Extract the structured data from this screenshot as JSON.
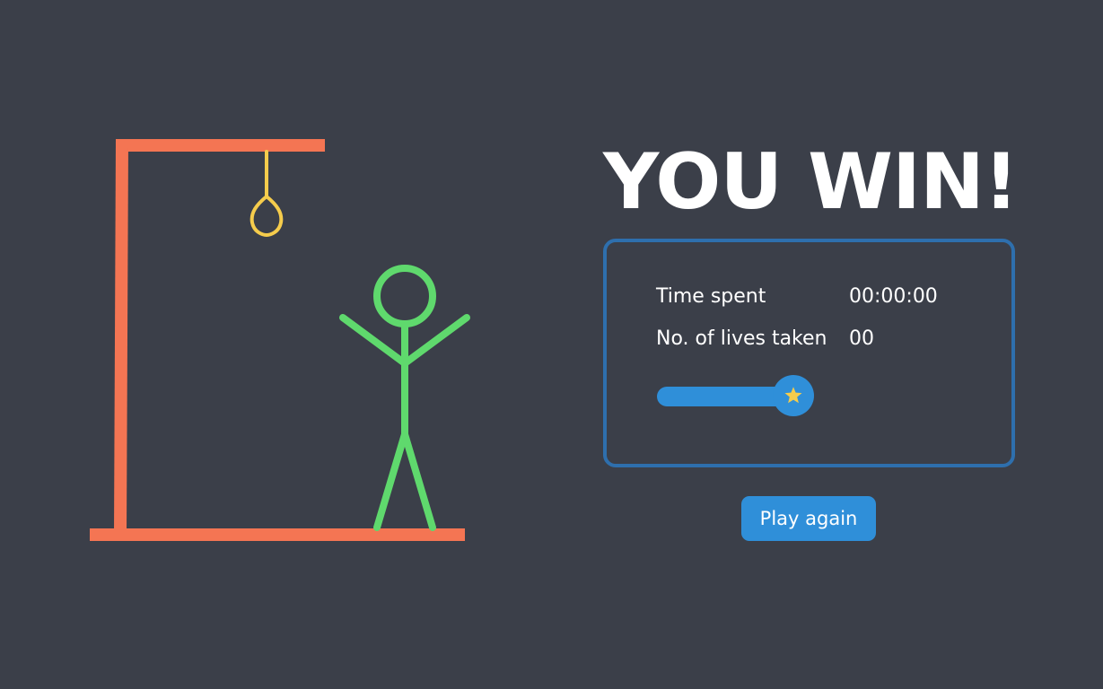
{
  "title": "YOU WIN!",
  "stats": {
    "time_label": "Time spent",
    "time_value": "00:00:00",
    "lives_label": "No. of lives taken",
    "lives_value": "00"
  },
  "rating": {
    "icon": "star-icon",
    "level": 1.0
  },
  "play_again_label": "Play again",
  "colors": {
    "background": "#3b3f49",
    "gallows": "#f47553",
    "noose": "#f5cc4c",
    "stickman": "#5fd96d",
    "panel_border": "#2e6fad",
    "accent": "#2f8fd9",
    "star": "#f5cc4c"
  }
}
